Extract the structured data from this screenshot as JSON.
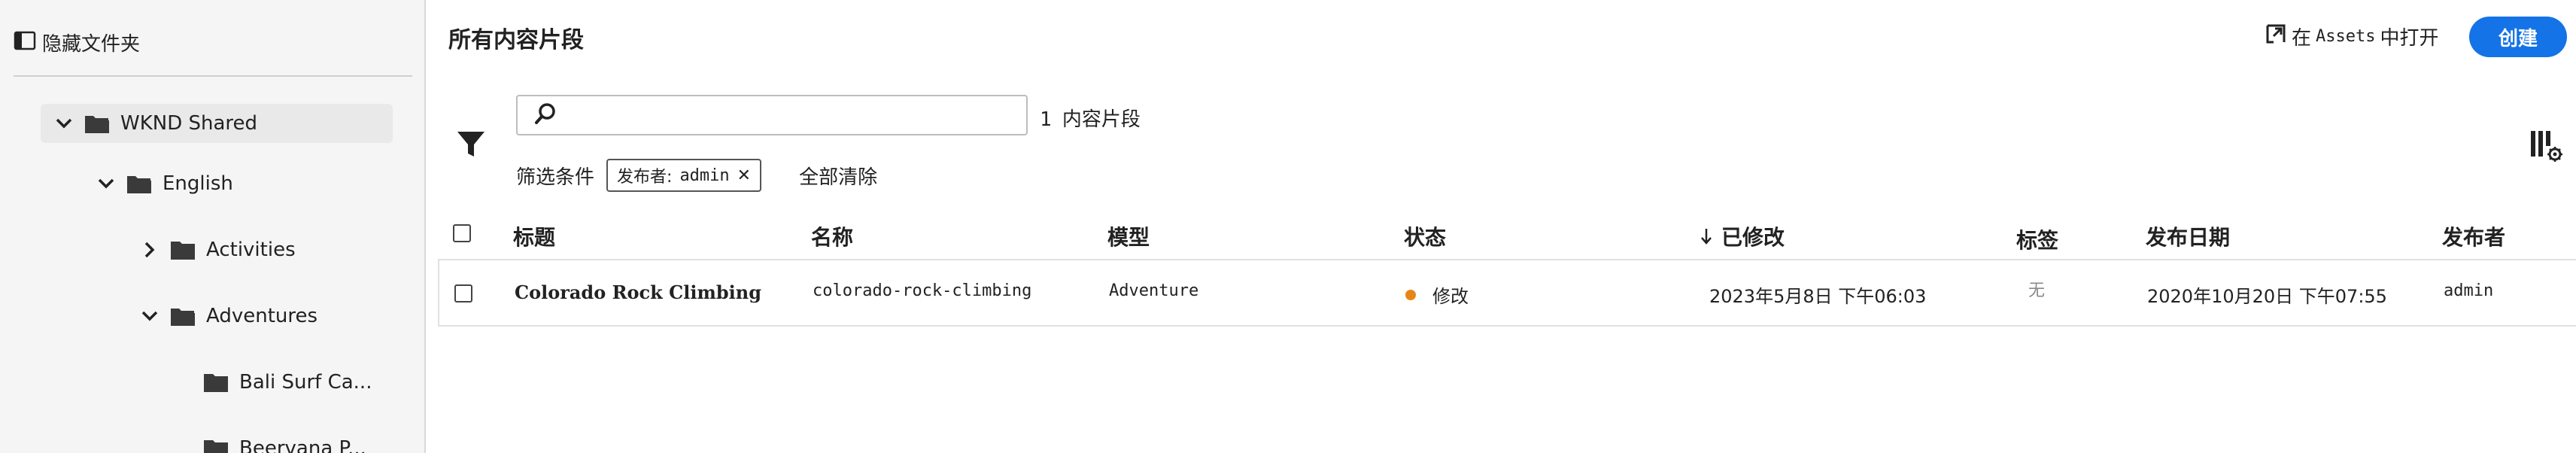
{
  "sidebar": {
    "hide_folders_label": "隐藏文件夹",
    "tree": [
      {
        "label": "WKND Shared",
        "expanded": true,
        "has_chevron": true
      },
      {
        "label": "English",
        "expanded": true,
        "has_chevron": true
      },
      {
        "label": "Activities",
        "expanded": false,
        "has_chevron": true
      },
      {
        "label": "Adventures",
        "expanded": true,
        "has_chevron": true
      },
      {
        "label": "Bali Surf Ca...",
        "has_chevron": false
      },
      {
        "label": "Beervana P...",
        "has_chevron": false
      }
    ]
  },
  "header": {
    "title": "所有内容片段",
    "open_in_prefix": "在",
    "open_in_assets": "Assets",
    "open_in_suffix": "中打开",
    "create_label": "创建"
  },
  "search": {
    "placeholder": "",
    "value": "",
    "result_count": "1",
    "result_label": "内容片段"
  },
  "filters": {
    "label": "筛选条件",
    "chips": [
      {
        "key": "发布者:",
        "value": "admin"
      }
    ],
    "clear_all": "全部清除"
  },
  "table": {
    "columns": {
      "title": "标题",
      "name": "名称",
      "model": "模型",
      "status": "状态",
      "modified": "已修改",
      "tags": "标签",
      "published_date": "发布日期",
      "publisher": "发布者"
    },
    "sort": {
      "column": "modified",
      "direction": "descending"
    },
    "rows": [
      {
        "title": "Colorado Rock Climbing",
        "name": "colorado-rock-climbing",
        "model": "Adventure",
        "status": "修改",
        "modified": "2023年5月8日 下午06:03",
        "tags": "无",
        "published_date": "2020年10月20日 下午07:55",
        "publisher": "admin"
      }
    ]
  },
  "colors": {
    "accent": "#1473e6",
    "status_modified": "#e68619",
    "sidebar_bg": "#f5f5f5"
  },
  "icons": {
    "hide_folders": "panel-left-icon",
    "folder": "folder-icon",
    "chevron_expanded": "chevron-down-icon",
    "chevron_collapsed": "chevron-right-icon",
    "open_external": "open-external-icon",
    "search": "search-icon",
    "filter": "filter-icon",
    "column_settings": "column-settings-icon",
    "sort_arrow": "arrow-down-icon"
  }
}
